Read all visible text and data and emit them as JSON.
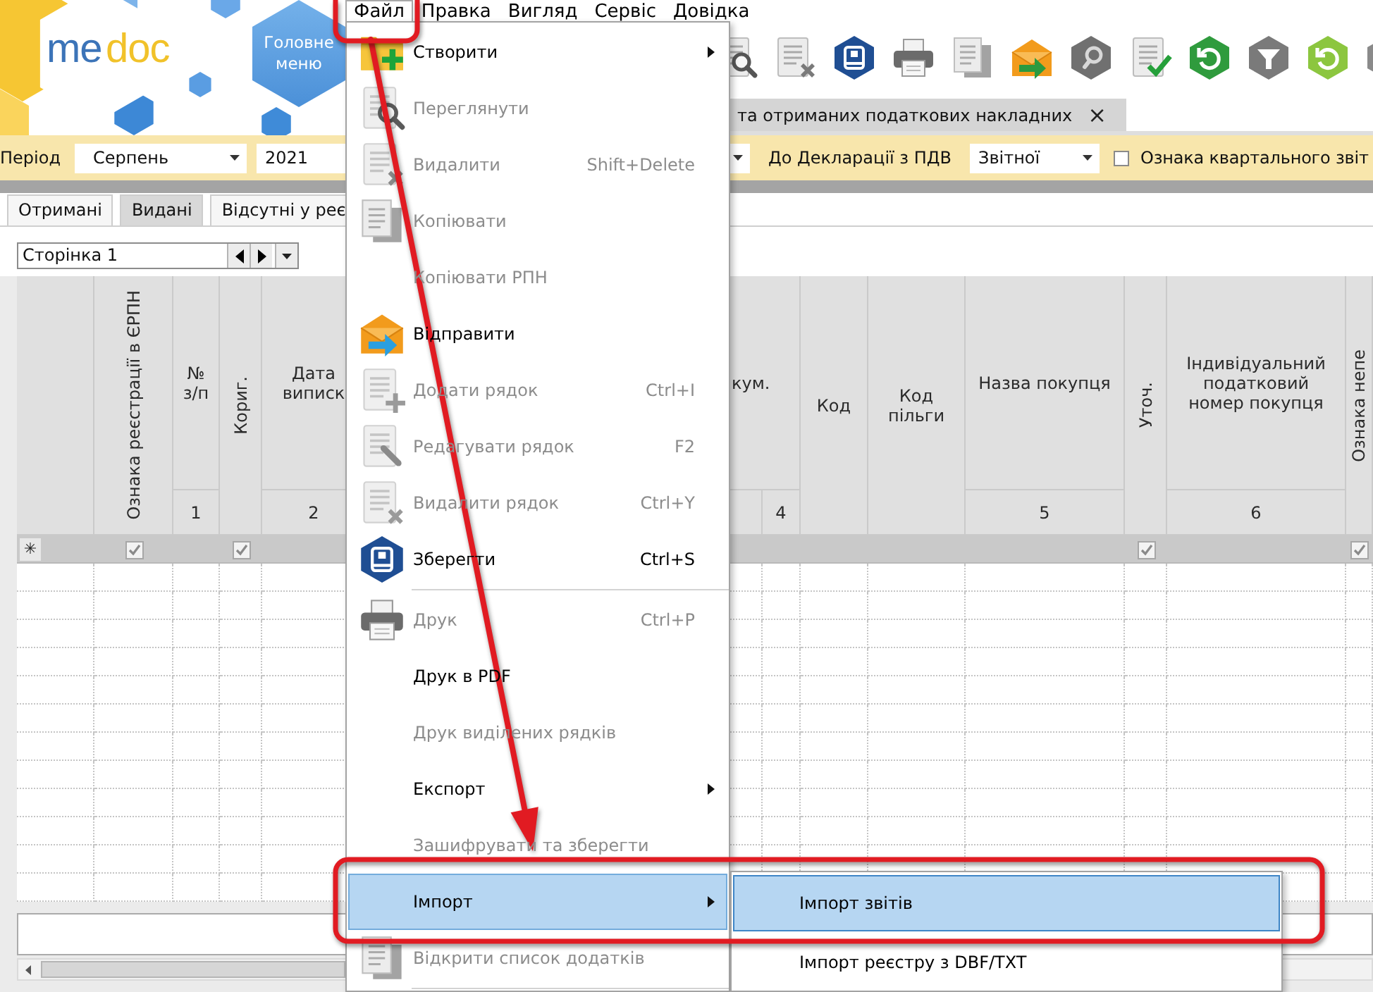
{
  "logo_words": [
    "me",
    "doc"
  ],
  "main_menu_button": "Головне меню",
  "menu_bar": [
    {
      "label": "Файл",
      "selected": true
    },
    {
      "label": "Правка",
      "selected": false
    },
    {
      "label": "Вигляд",
      "selected": false
    },
    {
      "label": "Сервіс",
      "selected": false
    },
    {
      "label": "Довідка",
      "selected": false
    }
  ],
  "document_tab": {
    "title": "та отриманих податкових накладних",
    "close": "×"
  },
  "filters": {
    "period_label": "Період",
    "month": "Серпень",
    "year": "2021",
    "declaration_label": "До Декларації з ПДВ",
    "declaration_type": "Звітної",
    "quarterly_checkbox": {
      "label": "Ознака квартального звіт",
      "checked": false
    }
  },
  "tabs": [
    {
      "label": "Отримані",
      "selected": false
    },
    {
      "label": "Видані",
      "selected": true
    },
    {
      "label": "Відсутні у реє",
      "selected": false
    }
  ],
  "pager": {
    "value": "Сторінка 1"
  },
  "table": {
    "new_row_marker": "✳",
    "columns": [
      {
        "kind": "vertical",
        "label": "Ознака реєстрації в ЄРПН",
        "new_row_checked": true
      },
      {
        "kind": "stacked",
        "label": "№ з/п",
        "number": "1"
      },
      {
        "kind": "vertical",
        "label": "Кориг.",
        "new_row_checked": true
      },
      {
        "kind": "stacked",
        "label": "Дата виписк",
        "number": "2"
      },
      {
        "kind": "group",
        "label": "кум.",
        "number": "4"
      },
      {
        "kind": "plain",
        "label": "Код"
      },
      {
        "kind": "plain",
        "label": "Код пільги"
      },
      {
        "kind": "stacked",
        "label": "Назва покупця",
        "number": "5"
      },
      {
        "kind": "vertical",
        "label": "Уточ.",
        "new_row_checked": true
      },
      {
        "kind": "stacked",
        "label": "Індивідуальний податковий номер покупця",
        "number": "6"
      },
      {
        "kind": "vertical",
        "label": "Ознака непе",
        "new_row_checked": true
      }
    ]
  },
  "file_menu": {
    "items": [
      {
        "kind": "item",
        "label": "Створити",
        "disabled": false,
        "submenu": true,
        "selected": false
      },
      {
        "kind": "item",
        "label": "Переглянути",
        "disabled": true,
        "submenu": false,
        "selected": false
      },
      {
        "kind": "item",
        "label": "Видалити",
        "shortcut": "Shift+Delete",
        "disabled": true,
        "submenu": false,
        "selected": false
      },
      {
        "kind": "item",
        "label": "Копіювати",
        "disabled": true,
        "submenu": false,
        "selected": false
      },
      {
        "kind": "item",
        "label": "Копіювати РПН",
        "disabled": true,
        "submenu": false,
        "selected": false
      },
      {
        "kind": "item",
        "label": "Відправити",
        "disabled": false,
        "submenu": false,
        "selected": false
      },
      {
        "kind": "item",
        "label": "Додати рядок",
        "shortcut": "Ctrl+I",
        "disabled": true,
        "submenu": false,
        "selected": false
      },
      {
        "kind": "item",
        "label": "Редагувати рядок",
        "shortcut": "F2",
        "disabled": true,
        "submenu": false,
        "selected": false
      },
      {
        "kind": "item",
        "label": "Видалити рядок",
        "shortcut": "Ctrl+Y",
        "disabled": true,
        "submenu": false,
        "selected": false
      },
      {
        "kind": "item",
        "label": "Зберегти",
        "shortcut": "Ctrl+S",
        "disabled": false,
        "submenu": false,
        "selected": false
      },
      {
        "kind": "separator"
      },
      {
        "kind": "item",
        "label": "Друк",
        "shortcut": "Ctrl+P",
        "disabled": true,
        "submenu": false,
        "selected": false
      },
      {
        "kind": "item",
        "label": "Друк в PDF",
        "disabled": false,
        "submenu": false,
        "selected": false
      },
      {
        "kind": "item",
        "label": "Друк виділених рядків",
        "disabled": true,
        "submenu": false,
        "selected": false
      },
      {
        "kind": "item",
        "label": "Експорт",
        "disabled": false,
        "submenu": true,
        "selected": false
      },
      {
        "kind": "item",
        "label": "Зашифрувати та зберегти",
        "disabled": true,
        "submenu": false,
        "selected": false
      },
      {
        "kind": "item",
        "label": "Імпорт",
        "disabled": false,
        "submenu": true,
        "selected": true
      },
      {
        "kind": "item",
        "label": "Відкрити список додатків",
        "disabled": true,
        "submenu": false,
        "selected": false
      },
      {
        "kind": "separator"
      }
    ]
  },
  "import_submenu": {
    "items": [
      {
        "label": "Імпорт звітів",
        "selected": true
      },
      {
        "label": "Імпорт реєстру з DBF/TXT",
        "selected": false
      }
    ]
  }
}
